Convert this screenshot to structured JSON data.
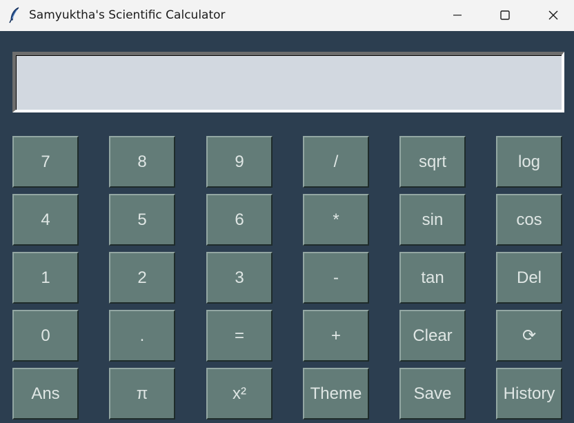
{
  "window": {
    "title": "Samyuktha's Scientific Calculator",
    "app_icon": "feather-icon",
    "controls": {
      "minimize_icon": "minimize-icon",
      "maximize_icon": "maximize-icon",
      "close_icon": "close-icon"
    }
  },
  "display": {
    "value": ""
  },
  "keypad": {
    "rows": [
      [
        "7",
        "8",
        "9",
        "/",
        "sqrt",
        "log"
      ],
      [
        "4",
        "5",
        "6",
        "*",
        "sin",
        "cos"
      ],
      [
        "1",
        "2",
        "3",
        "-",
        "tan",
        "Del"
      ],
      [
        "0",
        ".",
        "=",
        "+",
        "Clear",
        "⟳"
      ],
      [
        "Ans",
        "π",
        "x²",
        "Theme",
        "Save",
        "History"
      ]
    ]
  },
  "colors": {
    "background": "#2c3e50",
    "button": "#637c78",
    "button_text": "#dfe6e4",
    "display": "#d2d8e0",
    "titlebar": "#f3f3f3"
  }
}
